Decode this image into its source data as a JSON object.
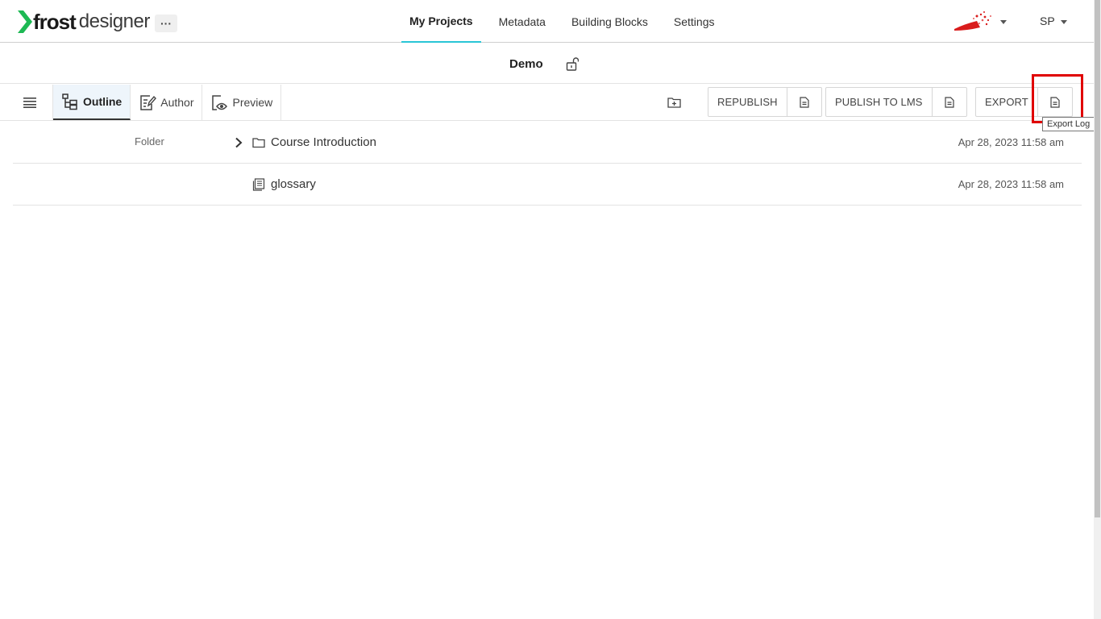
{
  "header": {
    "logo": {
      "word1": "frost",
      "word2": "designer",
      "accent_color": "#1db954"
    },
    "more_label": "···",
    "nav": [
      {
        "label": "My Projects",
        "active": true
      },
      {
        "label": "Metadata",
        "active": false
      },
      {
        "label": "Building Blocks",
        "active": false
      },
      {
        "label": "Settings",
        "active": false
      }
    ],
    "active_underline_color": "#29c5d6",
    "user_initials": "SP"
  },
  "project": {
    "title": "Demo",
    "lock_icon": "unlock-icon"
  },
  "toolbar": {
    "view_tabs": [
      {
        "label": "Outline",
        "icon": "outline-tree-icon",
        "active": true
      },
      {
        "label": "Author",
        "icon": "author-edit-icon",
        "active": false
      },
      {
        "label": "Preview",
        "icon": "preview-eye-icon",
        "active": false
      }
    ],
    "republish_label": "REPUBLISH",
    "publish_lms_label": "PUBLISH TO LMS",
    "export_label": "EXPORT",
    "tooltip": "Export Log",
    "highlight_color": "#e00000"
  },
  "items": [
    {
      "type": "Folder",
      "name": "Course Introduction",
      "icon": "folder-icon",
      "date": "Apr 28, 2023 11:58 am"
    },
    {
      "type": "",
      "name": "glossary",
      "icon": "page-stack-icon",
      "date": "Apr 28, 2023 11:58 am"
    }
  ]
}
